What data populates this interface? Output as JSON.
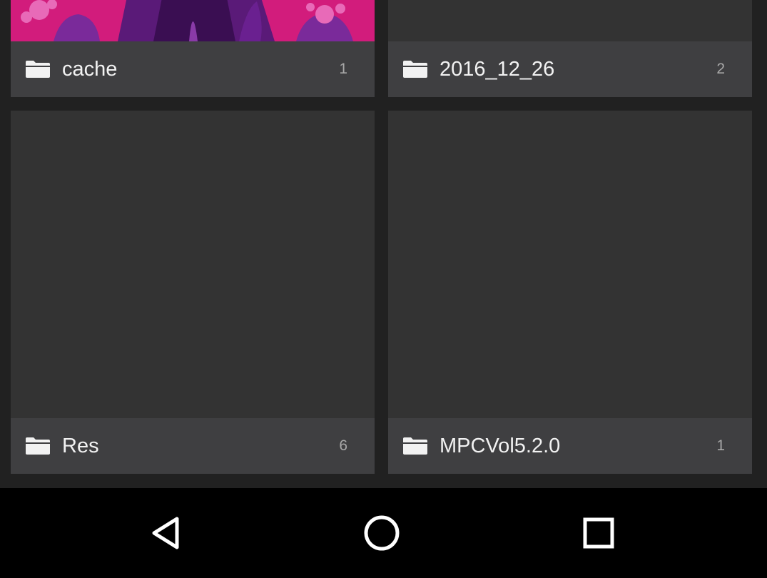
{
  "folders": [
    {
      "name": "cache",
      "count": "1",
      "icon": "folder-icon",
      "thumbnail": "pink-purple-artwork"
    },
    {
      "name": "2016_12_26",
      "count": "2",
      "icon": "folder-icon",
      "thumbnail": "none"
    },
    {
      "name": "Res",
      "count": "6",
      "icon": "folder-icon",
      "thumbnail": "none"
    },
    {
      "name": "MPCVol5.2.0",
      "count": "1",
      "icon": "folder-icon",
      "thumbnail": "none"
    }
  ],
  "navbar": {
    "back_icon": "back-triangle-icon",
    "home_icon": "home-circle-icon",
    "recents_icon": "recents-square-icon"
  },
  "colors": {
    "background": "#212121",
    "tile": "#333333",
    "footer": "#404042",
    "navbar": "#000000",
    "text": "#f2f2f2",
    "count": "#a8a8a8"
  }
}
